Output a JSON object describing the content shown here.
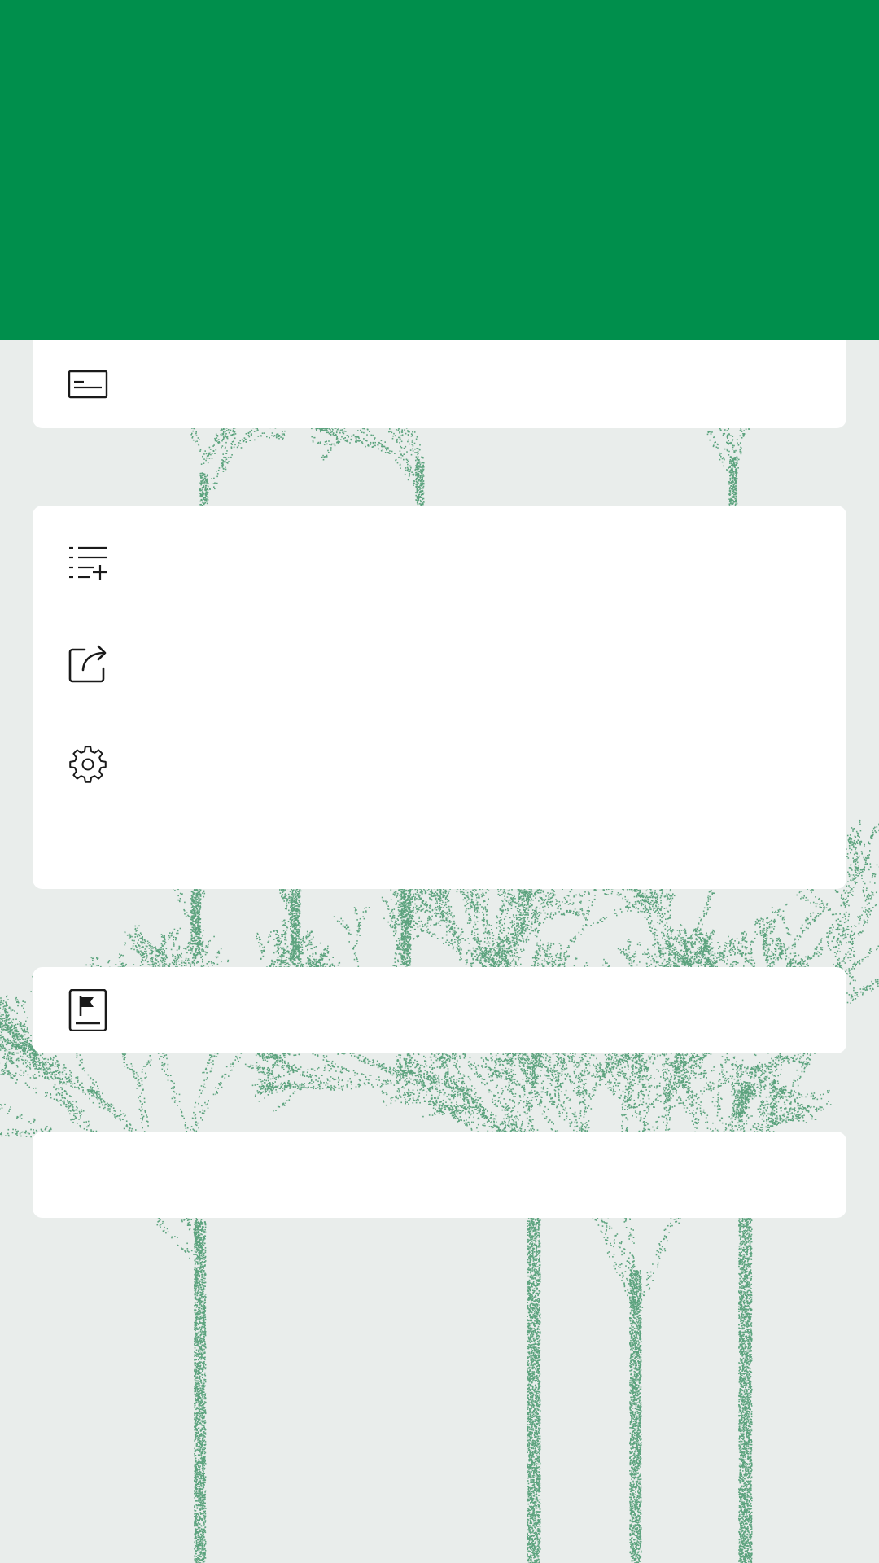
{
  "theme": {
    "header_color": "#008f4c",
    "background_color": "#e9edeb",
    "card_color": "#ffffff",
    "icon_color": "#1a1a1a",
    "tree_color": "#2e8b5a"
  },
  "header": {
    "title": ""
  },
  "sections": [
    {
      "items": [
        {
          "icon": "subtitles-icon",
          "label": ""
        }
      ]
    },
    {
      "items": [
        {
          "icon": "playlist-add-icon",
          "label": ""
        },
        {
          "icon": "share-icon",
          "label": ""
        },
        {
          "icon": "settings-gear-icon",
          "label": ""
        }
      ]
    },
    {
      "items": [
        {
          "icon": "report-flag-icon",
          "label": ""
        }
      ]
    },
    {
      "items": []
    }
  ]
}
